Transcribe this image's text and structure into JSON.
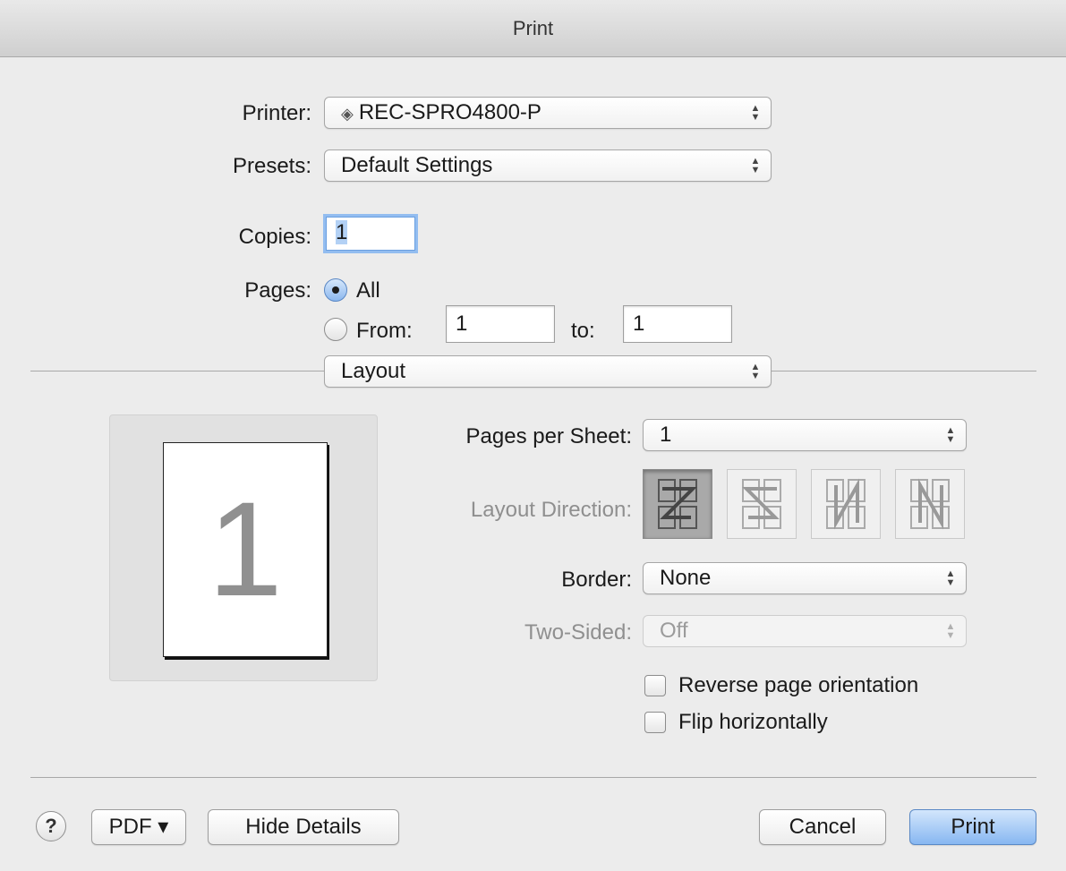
{
  "window": {
    "title": "Print"
  },
  "printer": {
    "label": "Printer:",
    "value": "REC-SPRO4800-P"
  },
  "presets": {
    "label": "Presets:",
    "value": "Default Settings"
  },
  "copies": {
    "label": "Copies:",
    "value": "1"
  },
  "pages": {
    "label": "Pages:",
    "all_label": "All",
    "from_label": "From:",
    "from_value": "1",
    "to_label": "to:",
    "to_value": "1",
    "selected": "All"
  },
  "section": {
    "value": "Layout"
  },
  "preview": {
    "page_number": "1"
  },
  "layout": {
    "pages_per_sheet_label": "Pages per Sheet:",
    "pages_per_sheet_value": "1",
    "direction_label": "Layout Direction:",
    "direction_options": [
      "Z",
      "reverse-Z",
      "reverse-N",
      "N"
    ],
    "direction_selected": "Z",
    "border_label": "Border:",
    "border_value": "None",
    "two_sided_label": "Two-Sided:",
    "two_sided_value": "Off",
    "reverse_orientation_label": "Reverse page orientation",
    "reverse_orientation_checked": false,
    "flip_horizontal_label": "Flip horizontally",
    "flip_horizontal_checked": false
  },
  "footer": {
    "help_label": "?",
    "pdf_label": "PDF ▾",
    "hide_details_label": "Hide Details",
    "cancel_label": "Cancel",
    "print_label": "Print"
  }
}
